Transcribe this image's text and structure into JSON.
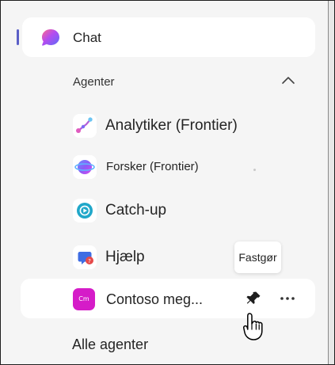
{
  "navigation": {
    "chat": {
      "label": "Chat",
      "icon": "chat-icon",
      "selected": true
    }
  },
  "agents_section": {
    "title": "Agenter",
    "expanded": true,
    "items": [
      {
        "label": "Analytiker (Frontier)",
        "icon": "analytics-agent-icon"
      },
      {
        "label": "Forsker (Frontier)",
        "icon": "researcher-agent-icon"
      },
      {
        "label": "Catch-up",
        "icon": "catch-up-agent-icon"
      },
      {
        "label": "Hjælp",
        "icon": "help-agent-icon"
      },
      {
        "label": "Contoso meg...",
        "icon": "contoso-agent-icon",
        "badge": "Cm",
        "hovered": true
      }
    ],
    "all_agents_label": "Alle agenter"
  },
  "tooltip": {
    "text": "Fastgør"
  },
  "actions": {
    "pin_icon": "pin-icon",
    "more_icon": "more-options-icon"
  },
  "colors": {
    "background": "#f5f5f5",
    "card": "#ffffff",
    "accent": "#5b5fc7",
    "text": "#242424"
  }
}
